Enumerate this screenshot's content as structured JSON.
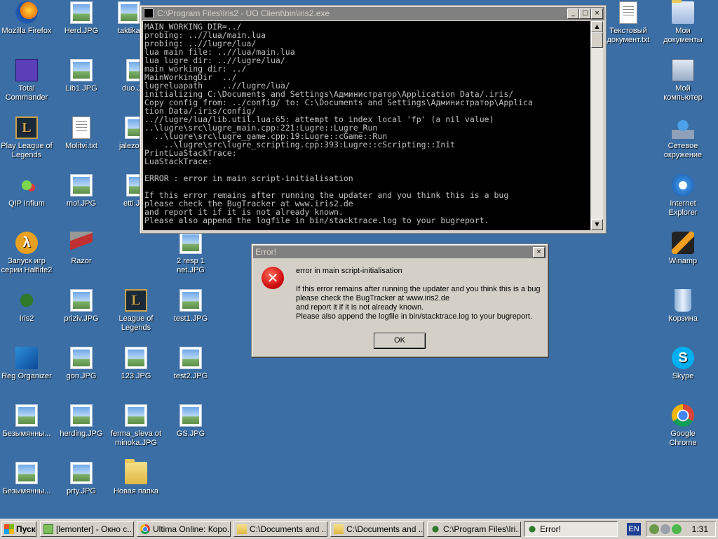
{
  "desktop": {
    "icons": [
      {
        "label": "Mozilla Firefox"
      },
      {
        "label": "Herd.JPG"
      },
      {
        "label": "taktika"
      },
      {
        "label": "Total Commander"
      },
      {
        "label": "Lib1.JPG"
      },
      {
        "label": "duo.JPG"
      },
      {
        "label": "Play League of Legends"
      },
      {
        "label": "Molitvi.txt"
      },
      {
        "label": "jalezo"
      },
      {
        "label": "QIP Infium"
      },
      {
        "label": "mol.JPG"
      },
      {
        "label": "etti.J"
      },
      {
        "label": "Запуск игр серии Halflife2"
      },
      {
        "label": "Razor"
      },
      {
        "label": "2 resp 1 net.JPG"
      },
      {
        "label": "Iris2"
      },
      {
        "label": "priziv.JPG"
      },
      {
        "label": "League of Legends"
      },
      {
        "label": "test1.JPG"
      },
      {
        "label": "Reg Organizer"
      },
      {
        "label": "gon.JPG"
      },
      {
        "label": "123.JPG"
      },
      {
        "label": "test2.JPG"
      },
      {
        "label": "Безымянны..."
      },
      {
        "label": "herding.JPG"
      },
      {
        "label": "ferma_sleva ot minoka.JPG"
      },
      {
        "label": "GS.JPG"
      },
      {
        "label": "Безымянны..."
      },
      {
        "label": "prty.JPG"
      },
      {
        "label": "Новая папка"
      },
      {
        "label": "Текстовый документ.txt"
      },
      {
        "label": "Мои документы"
      },
      {
        "label": "Мой компьютер"
      },
      {
        "label": "Сетевое окружение"
      },
      {
        "label": "Internet Explorer"
      },
      {
        "label": "Winamp"
      },
      {
        "label": "Корзина"
      },
      {
        "label": "Skype"
      },
      {
        "label": "Google Chrome"
      }
    ]
  },
  "console": {
    "title": "C:\\Program Files\\Iris2 - UO Client\\bin\\iris2.exe",
    "minimize": "_",
    "maximize": "□",
    "close": "×",
    "lines": [
      "MAIN_WORKING_DIR=../",
      "probing: ..//lua/main.lua",
      "probing: ..//lugre/lua/",
      "lua main file: ..//lua/main.lua",
      "lua lugre dir: ..//lugre/lua/",
      "main working dir: ../",
      "MainWorkingDir  ../",
      "lugreluapath    ..//lugre/lua/",
      "initializing C:\\Documents and Settings\\Администратор\\Application Data/.iris/",
      "Copy config from: ../config/ to: C:\\Documents and Settings\\Администратор\\Applica",
      "tion Data/.iris/config/",
      "..//lugre/lua/lib.util.lua:65: attempt to index local 'fp' (a nil value)",
      "..\\lugre\\src\\lugre_main.cpp:221:Lugre::Lugre_Run",
      "  ..\\lugre\\src\\lugre_game.cpp:19:Lugre::cGame::Run",
      "    ..\\lugre\\src\\lugre_scripting.cpp:393:Lugre::cScripting::Init",
      "PrintLuaStackTrace:",
      "LuaStackTrace:",
      "",
      "ERROR : error in main script-initialisation",
      "",
      "If this error remains after running the updater and you think this is a bug",
      "please check the BugTracker at www.iris2.de",
      "and report it if it is not already known.",
      "Please also append the logfile in bin/stacktrace.log to your bugreport."
    ]
  },
  "dialog": {
    "title": "Error!",
    "close": "×",
    "icon": "error-x-icon",
    "icon_glyph": "✕",
    "line1": "error in main script-initialisation",
    "line2": "If this error remains after running the updater and you think this is a bug",
    "line3": "please check the BugTracker at www.iris2.de",
    "line4": "and report it if it is not already known.",
    "line5": "Please also append the logfile in bin/stacktrace.log to your bugreport.",
    "ok_label": "OK"
  },
  "taskbar": {
    "start_label": "Пуск",
    "tasks": [
      {
        "label": "[lemonter] - Окно с..."
      },
      {
        "label": "Ultima Online: Коро..."
      },
      {
        "label": "C:\\Documents and ..."
      },
      {
        "label": "C:\\Documents and ..."
      },
      {
        "label": "C:\\Program Files\\Iri..."
      },
      {
        "label": "Error!"
      }
    ],
    "language": "EN",
    "clock": "1:31"
  }
}
